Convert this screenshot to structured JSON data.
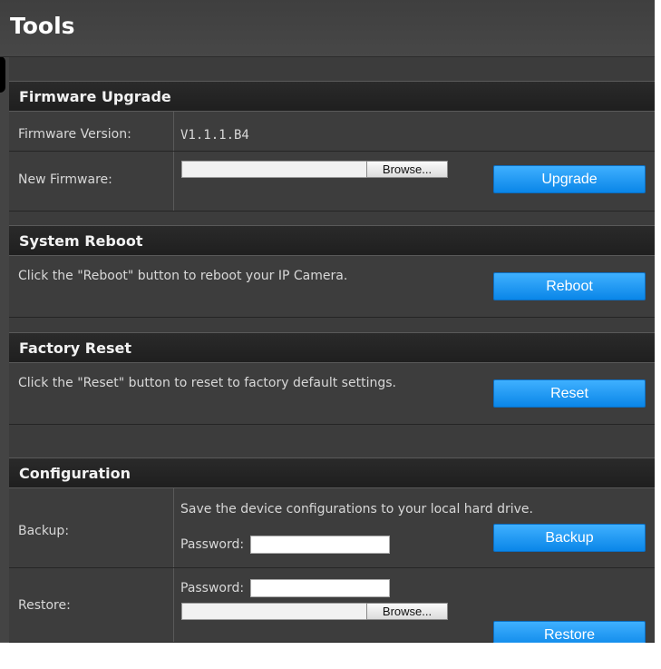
{
  "page": {
    "title": "Tools"
  },
  "firmware": {
    "header": "Firmware Upgrade",
    "version_label": "Firmware Version:",
    "version_value": "V1.1.1.B4",
    "new_label": "New Firmware:",
    "browse_label": "Browse...",
    "upgrade_label": "Upgrade"
  },
  "reboot": {
    "header": "System Reboot",
    "text": "Click the \"Reboot\" button to reboot your IP Camera.",
    "button_label": "Reboot"
  },
  "reset": {
    "header": "Factory Reset",
    "text": "Click the \"Reset\" button to reset to factory default settings.",
    "button_label": "Reset"
  },
  "config": {
    "header": "Configuration",
    "backup_label": "Backup:",
    "backup_desc": "Save the device configurations to your local hard drive.",
    "password_label": "Password:",
    "backup_password_value": "",
    "backup_button": "Backup",
    "restore_label": "Restore:",
    "restore_password_value": "",
    "browse_label": "Browse...",
    "restore_button": "Restore"
  },
  "colors": {
    "accent_button": "#1a9af5",
    "header_bg": "#222222",
    "panel_bg": "#444444"
  }
}
